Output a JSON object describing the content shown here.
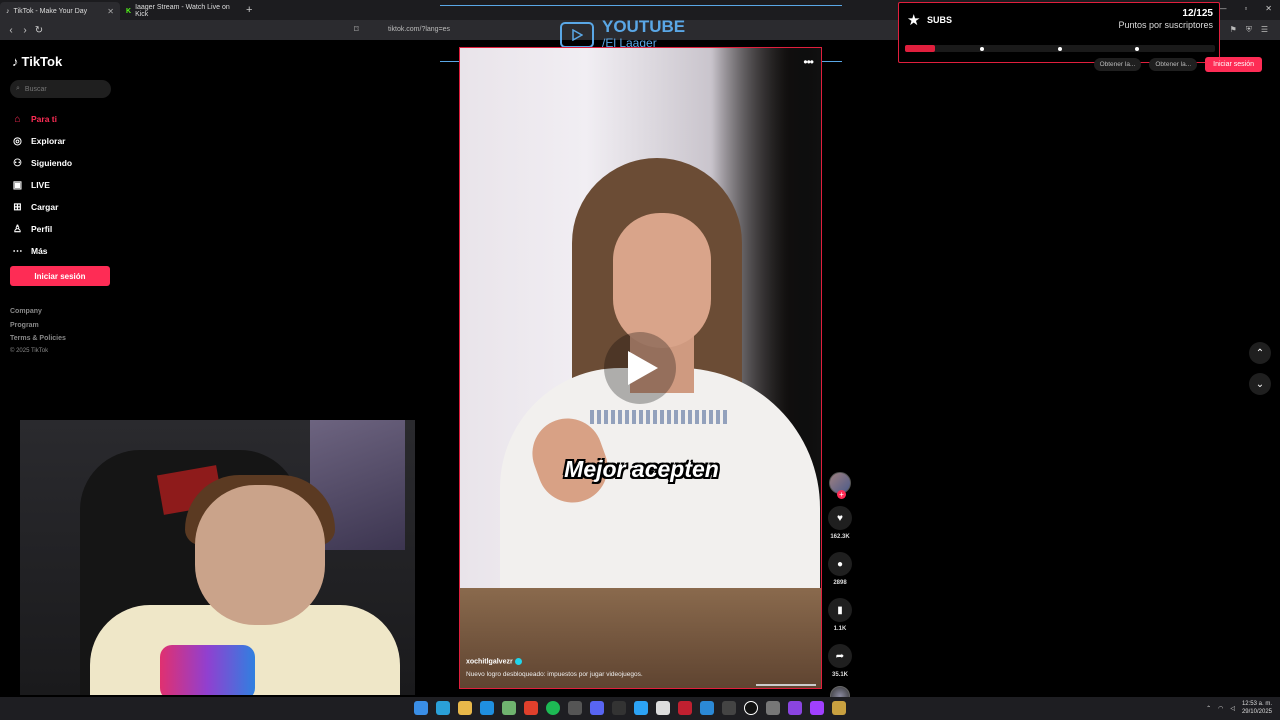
{
  "browser": {
    "tabs": [
      {
        "title": "TikTok - Make Your Day",
        "active": true
      },
      {
        "title": "Iaager Stream - Watch Live on Kick",
        "active": false
      }
    ],
    "url": "tiktok.com/?lang=es"
  },
  "sidebar": {
    "logo": "TikTok",
    "search_placeholder": "Buscar",
    "items": [
      {
        "label": "Para ti",
        "icon": "home-icon",
        "selected": true
      },
      {
        "label": "Explorar",
        "icon": "compass-icon"
      },
      {
        "label": "Siguiendo",
        "icon": "following-icon"
      },
      {
        "label": "LIVE",
        "icon": "live-icon"
      },
      {
        "label": "Cargar",
        "icon": "upload-icon"
      },
      {
        "label": "Perfil",
        "icon": "profile-icon"
      },
      {
        "label": "Más",
        "icon": "more-icon"
      }
    ],
    "login_label": "Iniciar sesión",
    "footer": [
      "Company",
      "Program",
      "Terms & Policies"
    ],
    "copyright": "© 2025 TikTok"
  },
  "video": {
    "caption": "Mejor acepten",
    "author": "xochitlgalvezr",
    "description": "Nuevo logro desbloqueado: impuestos por jugar videojuegos."
  },
  "actions": {
    "likes": "162.3K",
    "comments": "2898",
    "saves": "1.1K",
    "shares": "35.1K"
  },
  "overlay": {
    "youtube_title": "YOUTUBE",
    "youtube_channel": "/El Laager"
  },
  "subs_widget": {
    "label": "SUBS",
    "count": "12/125",
    "subtitle": "Puntos por suscriptores",
    "progress_fraction": 0.096,
    "accent": "#e01f3d"
  },
  "top_right": {
    "btn1": "Obtener la...",
    "btn2": "Obtener la...",
    "login": "Iniciar sesión"
  },
  "taskbar": {
    "time": "12:53 a. m.",
    "date": "29/10/2025"
  },
  "colors": {
    "tiktok_red": "#fe2c55",
    "overlay_blue": "#5aa7e6"
  }
}
